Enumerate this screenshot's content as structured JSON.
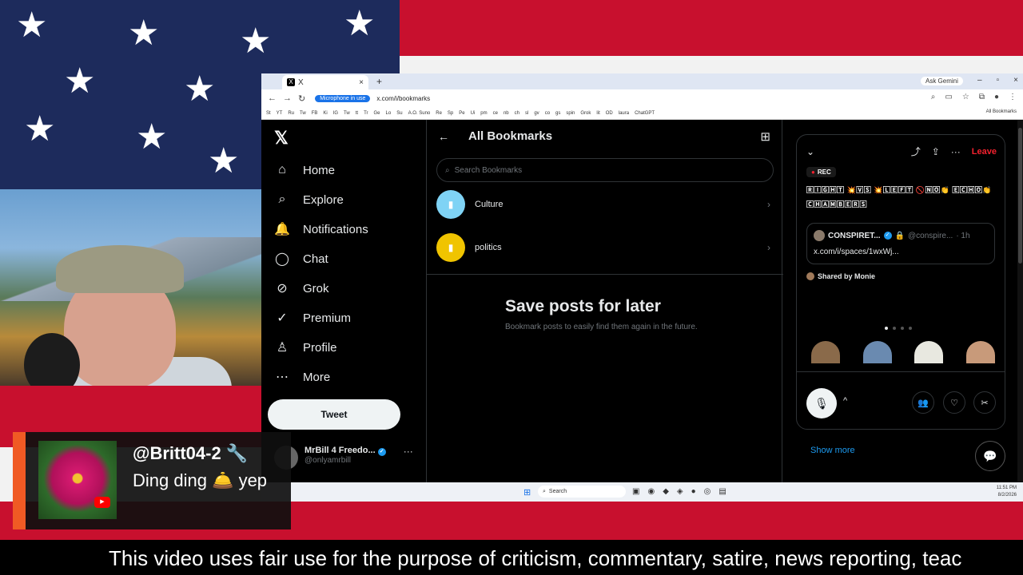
{
  "colors": {
    "accent": "#1d9bf0",
    "leave": "#f4212e",
    "chat_accent": "#f05a24",
    "flag_blue": "#1d2b5c",
    "flag_red": "#c8102e"
  },
  "browser": {
    "tab_title": "X",
    "tab_icon": "x-logo-icon",
    "gemini": "Ask Gemini",
    "mic_pill": "Microphone in use",
    "url": "x.com/i/bookmarks",
    "bookmarks": [
      "St",
      "YT",
      "Ru",
      "Tw",
      "FB",
      "Ki",
      "IG",
      "Tw",
      "tt",
      "Tr",
      "Ge",
      "Lo",
      "Su",
      "A.O. Suno",
      "Re",
      "Sp",
      "Pe",
      "Ui",
      "pm",
      "ce",
      "nb",
      "ch",
      "sl",
      "gv",
      "co",
      "gs",
      "spin",
      "Grok",
      "lit",
      "OD",
      "laura",
      "ChatGPT"
    ],
    "all_bookmarks": "All Bookmarks"
  },
  "sidebar": {
    "logo": "𝕏",
    "items": [
      {
        "label": "Home",
        "icon": "⌂",
        "icon_name": "home-icon"
      },
      {
        "label": "Explore",
        "icon": "⌕",
        "icon_name": "search-icon"
      },
      {
        "label": "Notifications",
        "icon": "🔔",
        "icon_name": "bell-icon"
      },
      {
        "label": "Chat",
        "icon": "◯",
        "icon_name": "chat-icon"
      },
      {
        "label": "Grok",
        "icon": "⊘",
        "icon_name": "grok-icon"
      },
      {
        "label": "Premium",
        "icon": "✓",
        "icon_name": "premium-icon"
      },
      {
        "label": "Profile",
        "icon": "♙",
        "icon_name": "profile-icon"
      },
      {
        "label": "More",
        "icon": "⋯",
        "icon_name": "more-icon"
      }
    ],
    "tweet_label": "Tweet",
    "account": {
      "name": "MrBill 4 Freedo...",
      "handle": "@onlyamrbill"
    }
  },
  "main": {
    "title": "All Bookmarks",
    "search_placeholder": "Search Bookmarks",
    "folders": [
      {
        "label": "Culture",
        "color": "#7fd3f5"
      },
      {
        "label": "politics",
        "color": "#f0c400"
      }
    ],
    "empty_title": "Save posts for later",
    "empty_text": "Bookmark posts to easily find them again in the future."
  },
  "space": {
    "leave": "Leave",
    "rec": "REC",
    "title": "🅁🄸🄶🄷🅃 💥🅅🅂 💥🄻🄴🄵🅃 🚫🄽🄾👏 🄴🄲🄷🄾👏🄲🄷🄰🄼🄱🄴🅁🅂",
    "embed": {
      "name": "CONSPIRET...",
      "handle": "@conspire...",
      "time": "· 1h",
      "link": "x.com/i/spaces/1wxWj..."
    },
    "shared_by": "Shared by Monie",
    "show_more": "Show more"
  },
  "taskbar": {
    "search": "Search",
    "time": "11:51 PM",
    "date": "8/2/2026"
  },
  "chat": {
    "user": "@Britt04-2 🔧",
    "message": "Ding ding 🛎️ yep",
    "badge": "▶"
  },
  "ticker": "This video uses fair use for the purpose of criticism, commentary, satire, news reporting, teac"
}
